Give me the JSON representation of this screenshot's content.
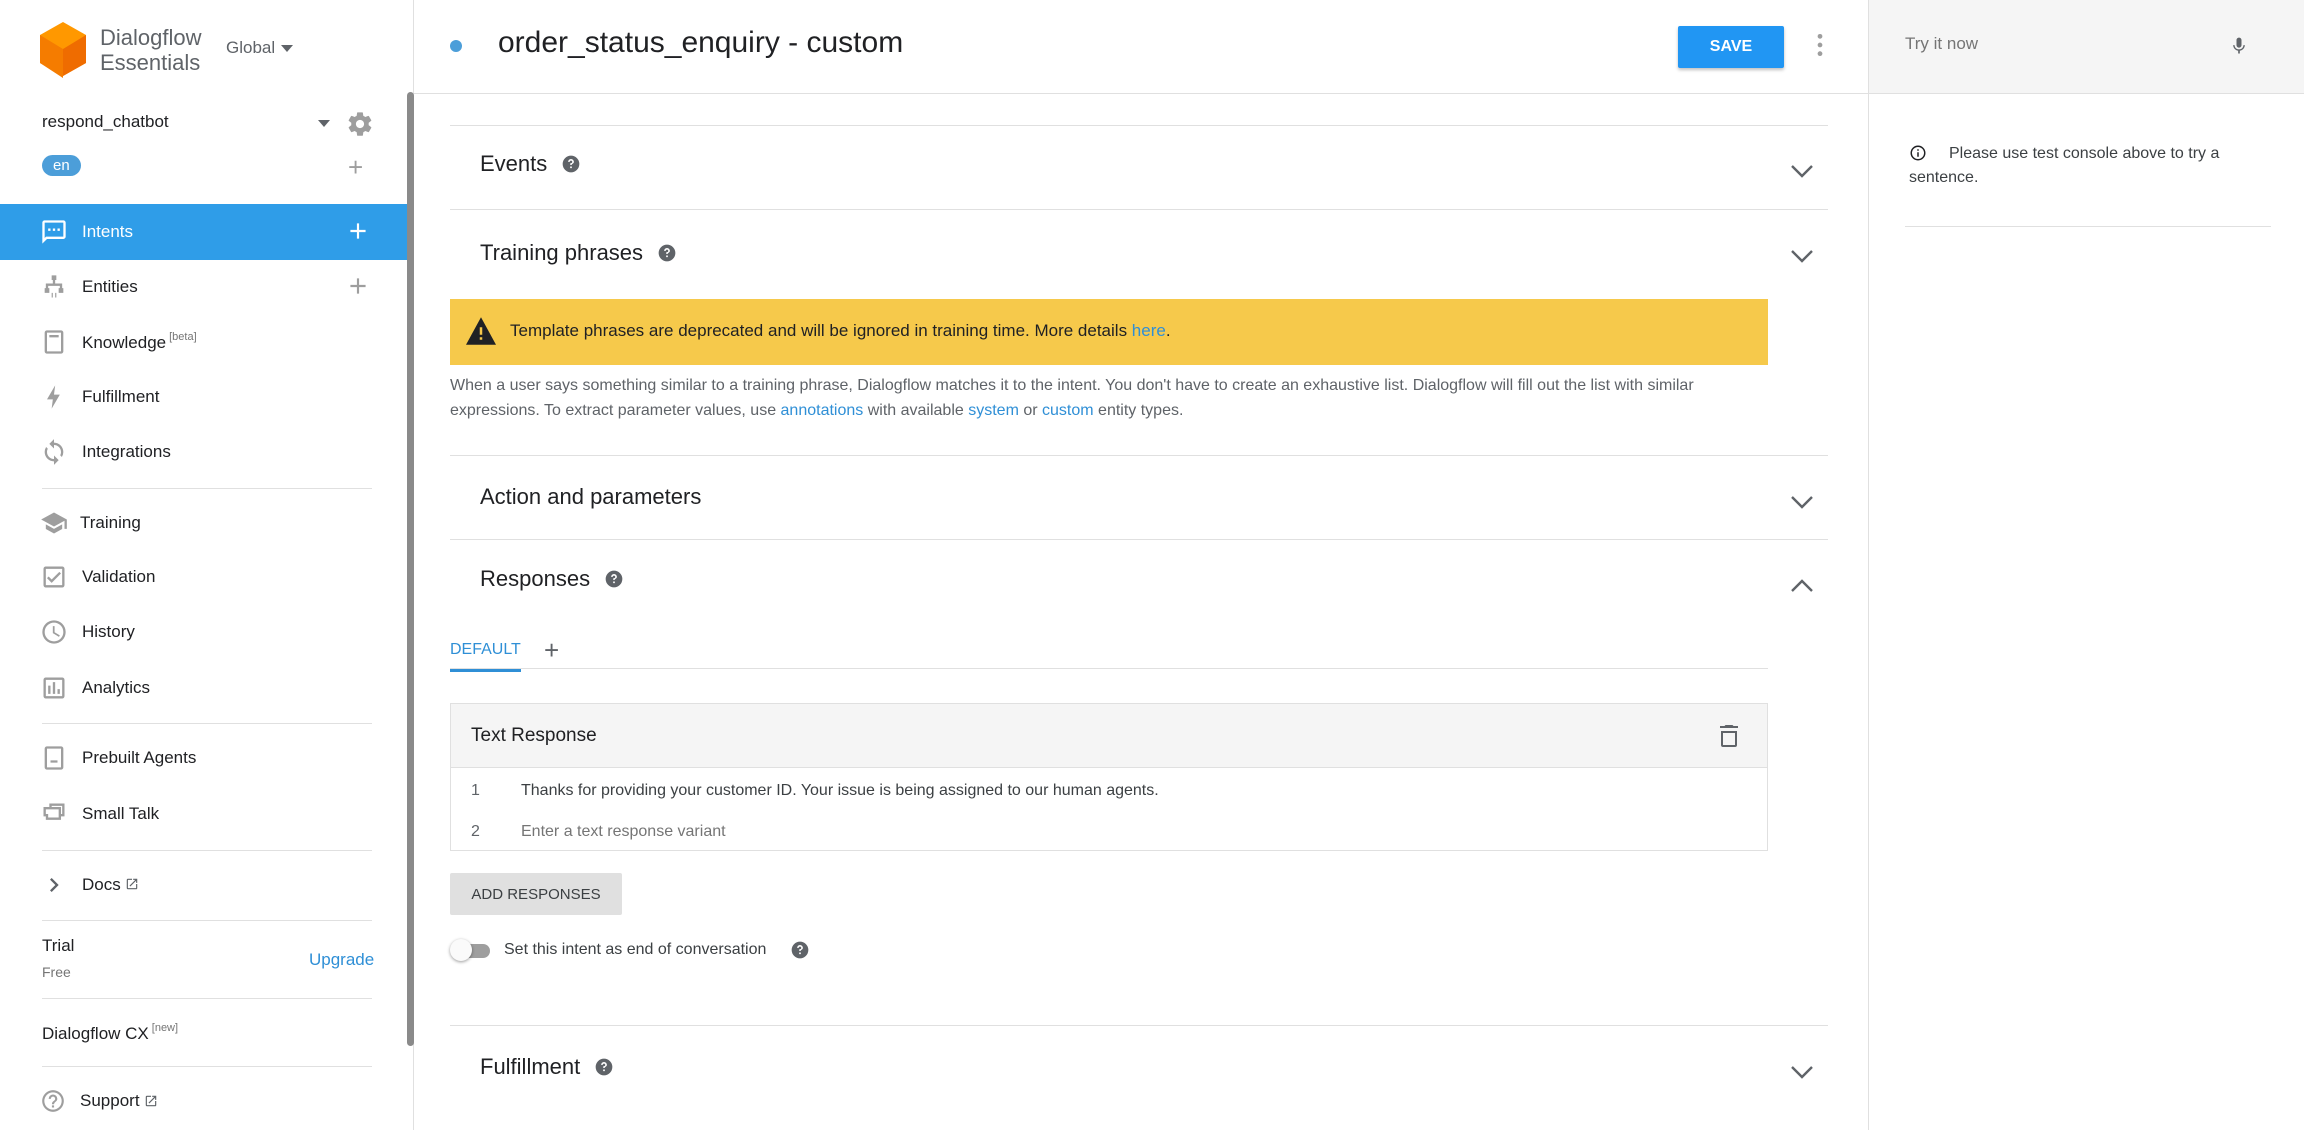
{
  "brand": {
    "line1": "Dialogflow",
    "line2": "Essentials",
    "region": "Global"
  },
  "agent": {
    "name": "respond_chatbot",
    "language": "en"
  },
  "sidebar": {
    "items": [
      {
        "label": "Intents",
        "icon": "chat-bubble-icon"
      },
      {
        "label": "Entities",
        "icon": "hierarchy-icon"
      },
      {
        "label": "Knowledge",
        "tag": "[beta]",
        "icon": "book-icon"
      },
      {
        "label": "Fulfillment",
        "icon": "bolt-icon"
      },
      {
        "label": "Integrations",
        "icon": "sync-icon"
      },
      {
        "label": "Training",
        "icon": "graduation-cap-icon"
      },
      {
        "label": "Validation",
        "icon": "checkbox-icon"
      },
      {
        "label": "History",
        "icon": "clock-icon"
      },
      {
        "label": "Analytics",
        "icon": "bar-chart-icon"
      },
      {
        "label": "Prebuilt Agents",
        "icon": "agent-book-icon"
      },
      {
        "label": "Small Talk",
        "icon": "chat-squares-icon"
      },
      {
        "label": "Docs",
        "icon": "chevron-right-icon"
      }
    ],
    "trial": {
      "label": "Trial",
      "plan": "Free",
      "upgrade": "Upgrade"
    },
    "cx": {
      "label": "Dialogflow CX",
      "tag": "[new]"
    },
    "support": "Support"
  },
  "header": {
    "title": "order_status_enquiry - custom",
    "save": "SAVE"
  },
  "main": {
    "events": {
      "title": "Events"
    },
    "training": {
      "title": "Training phrases",
      "warning_prefix": "Template phrases are deprecated and will be ignored in training time. More details ",
      "warning_link": "here",
      "warning_suffix": ".",
      "desc_1": "When a user says something similar to a training phrase, Dialogflow matches it to the intent. You don't have to create an exhaustive list. Dialogflow will fill out the list with similar expressions. To extract parameter values, use ",
      "desc_link_annotations": "annotations",
      "desc_2": " with available ",
      "desc_link_system": "system",
      "desc_3": " or ",
      "desc_link_custom": "custom",
      "desc_4": " entity types."
    },
    "actions": {
      "title": "Action and parameters"
    },
    "responses": {
      "title": "Responses",
      "tab_default": "DEFAULT",
      "card_title": "Text Response",
      "rows": [
        {
          "num": "1",
          "text": "Thanks for providing your customer ID. Your issue is being assigned to our human agents."
        },
        {
          "num": "2",
          "placeholder": "Enter a text response variant"
        }
      ],
      "add_button": "ADD RESPONSES",
      "end_conversation_label": "Set this intent as end of conversation"
    },
    "fulfillment": {
      "title": "Fulfillment"
    }
  },
  "right_panel": {
    "try_placeholder": "Try it now",
    "info": "Please use test console above to try a sentence."
  },
  "colors": {
    "accent": "#2f9de8",
    "save": "#2196f3",
    "warning": "#f6c94b",
    "link": "#2f8fd6",
    "brand_orange": "#f57c00"
  }
}
